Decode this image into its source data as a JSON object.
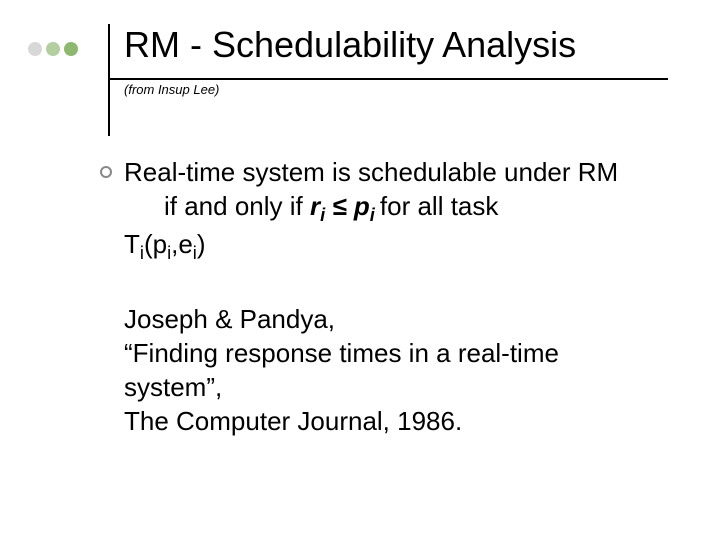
{
  "title": "RM - Schedulability Analysis",
  "subtitle": "(from Insup Lee)",
  "body": {
    "line1": "Real-time system is schedulable under RM",
    "line2_pre": "if and only if ",
    "r": "r",
    "sub_i1": "i",
    "leq": " ≤ ",
    "p": "p",
    "sub_i2": "i ",
    "line2_post": "for all task ",
    "T": "T",
    "sub_i3": "i",
    "open": "(p",
    "sub_i4": "i",
    "comma": ",e",
    "sub_i5": "i",
    "close": ")",
    "ref1": "Joseph & Pandya,",
    "ref2": "“Finding response times in a real-time system”,",
    "ref3": "The Computer Journal, 1986."
  }
}
